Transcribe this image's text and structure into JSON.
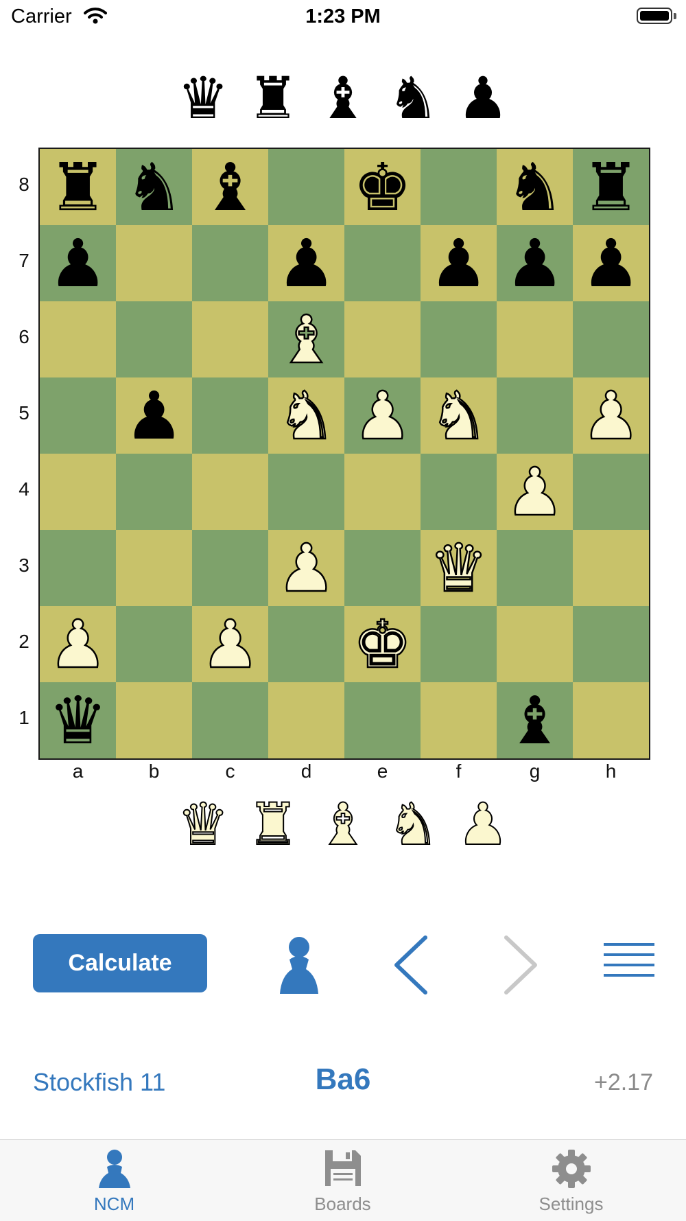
{
  "status_bar": {
    "carrier": "Carrier",
    "time": "1:23 PM"
  },
  "board": {
    "light_color": "#c8c26a",
    "dark_color": "#7ea26b",
    "ranks": [
      "8",
      "7",
      "6",
      "5",
      "4",
      "3",
      "2",
      "1"
    ],
    "files": [
      "a",
      "b",
      "c",
      "d",
      "e",
      "f",
      "g",
      "h"
    ],
    "position": [
      [
        "r",
        "n",
        "b",
        "",
        "k",
        "",
        "n",
        "r"
      ],
      [
        "p",
        "",
        "",
        "p",
        "",
        "p",
        "p",
        "p"
      ],
      [
        "",
        "",
        "",
        "B",
        "",
        "",
        "",
        ""
      ],
      [
        "",
        "p",
        "",
        "N",
        "P",
        "N",
        "",
        "P"
      ],
      [
        "",
        "",
        "",
        "",
        "",
        "",
        "P",
        ""
      ],
      [
        "",
        "",
        "",
        "P",
        "",
        "Q",
        "",
        ""
      ],
      [
        "P",
        "",
        "P",
        "",
        "K",
        "",
        "",
        ""
      ],
      [
        "q",
        "",
        "",
        "",
        "",
        "",
        "b",
        ""
      ]
    ]
  },
  "captured_by_white": [
    "q",
    "r",
    "b",
    "n",
    "p"
  ],
  "captured_by_black": [
    "Q",
    "R",
    "B",
    "N",
    "P"
  ],
  "toolbar": {
    "calculate_label": "Calculate",
    "accent_color": "#3478bd",
    "side_to_move_icon": "pawn-icon",
    "back_icon": "chevron-left-icon",
    "forward_icon": "chevron-right-icon",
    "forward_enabled": false,
    "menu_icon": "menu-lines-icon"
  },
  "analysis": {
    "engine": "Stockfish 11",
    "best_move": "Ba6",
    "evaluation": "+2.17"
  },
  "tab_bar": {
    "selected": "NCM",
    "tabs": [
      {
        "label": "NCM",
        "icon": "player-icon"
      },
      {
        "label": "Boards",
        "icon": "floppy-disk-icon"
      },
      {
        "label": "Settings",
        "icon": "gear-icon"
      }
    ]
  }
}
